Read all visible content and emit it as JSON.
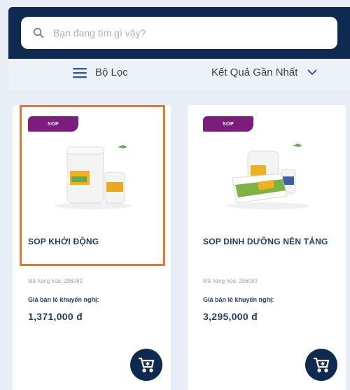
{
  "search": {
    "placeholder": "Bạn đang tìm gì vậy?"
  },
  "filter": {
    "label": "Bộ Lọc"
  },
  "sort": {
    "label": "Kết Quả Gần Nhất"
  },
  "products": [
    {
      "badge": "SOP",
      "name": "SOP KHỞI ĐỘNG",
      "sku": "Mã hàng hóa: 296082",
      "price_label": "Giá bán lẻ khuyến nghị:",
      "price": "1,371,000 đ"
    },
    {
      "badge": "SOP",
      "name": "SOP DINH DƯỠNG NỀN TẢNG",
      "sku": "Mã hàng hóa: 296083",
      "price_label": "Giá bán lẻ khuyến nghị:",
      "price": "3,295,000 đ"
    }
  ],
  "colors": {
    "navy": "#0f2a50",
    "badge": "#7b1d7a",
    "highlight": "#e07a30",
    "text": "#1f3d6b"
  },
  "icons": {
    "search": "search-icon",
    "filter": "filter-lines-icon",
    "sort": "chevron-down-icon",
    "cart": "cart-icon"
  }
}
